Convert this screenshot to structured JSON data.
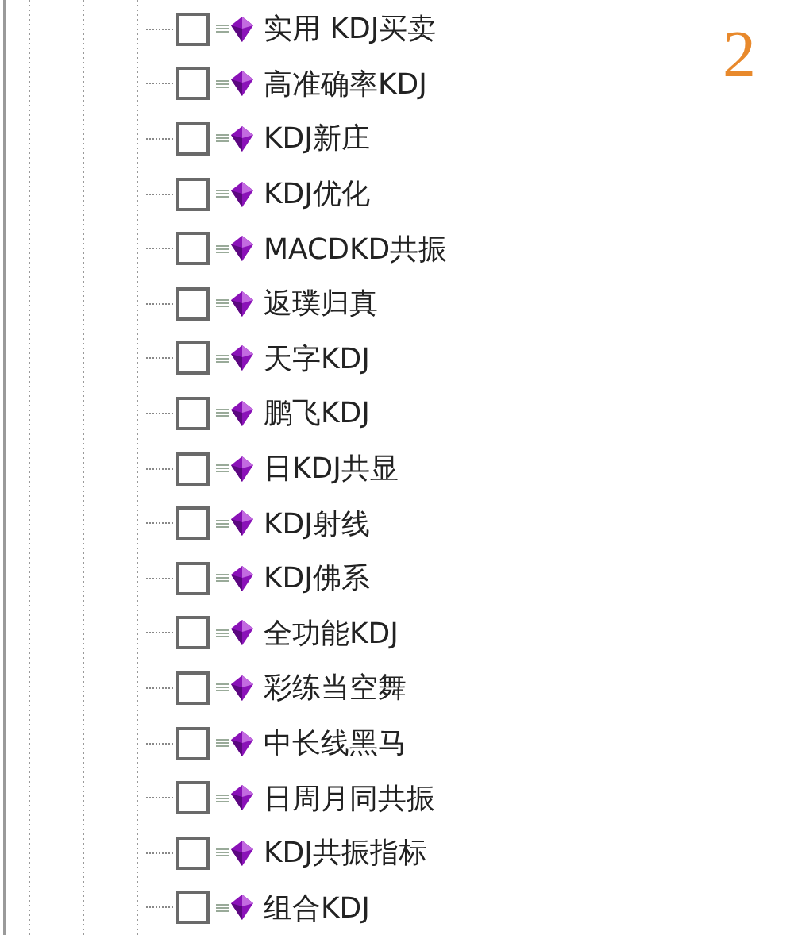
{
  "tree": {
    "items": [
      {
        "label": "实用 KDJ买卖",
        "checked": false
      },
      {
        "label": "高准确率KDJ",
        "checked": false
      },
      {
        "label": "KDJ新庄",
        "checked": false
      },
      {
        "label": "KDJ优化",
        "checked": false
      },
      {
        "label": "MACDKD共振",
        "checked": false
      },
      {
        "label": "返璞归真",
        "checked": false
      },
      {
        "label": "天字KDJ",
        "checked": false
      },
      {
        "label": "鹏飞KDJ",
        "checked": false
      },
      {
        "label": "日KDJ共显",
        "checked": false
      },
      {
        "label": "KDJ射线",
        "checked": false
      },
      {
        "label": "KDJ佛系",
        "checked": false
      },
      {
        "label": "全功能KDJ",
        "checked": false
      },
      {
        "label": "彩练当空舞",
        "checked": false
      },
      {
        "label": "中长线黑马",
        "checked": false
      },
      {
        "label": "日周月同共振",
        "checked": false
      },
      {
        "label": "KDJ共振指标",
        "checked": false
      },
      {
        "label": "组合KDJ",
        "checked": false
      }
    ]
  },
  "page_number": "2"
}
